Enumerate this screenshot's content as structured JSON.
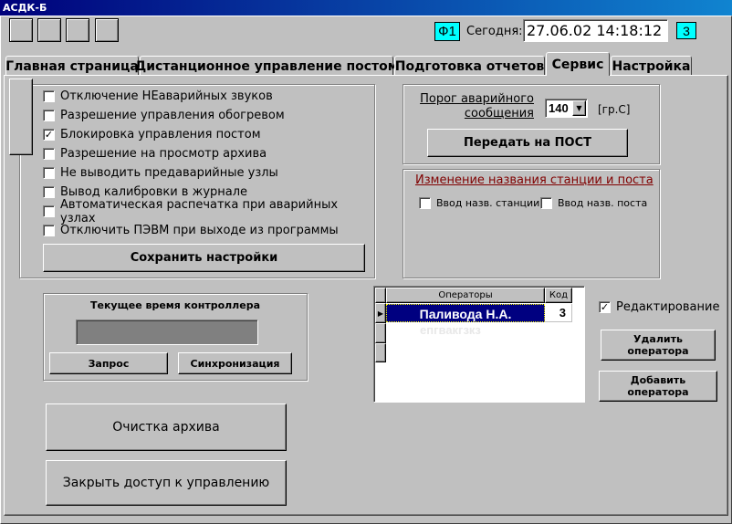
{
  "titlebar": {
    "title": "АСДК-Б"
  },
  "header": {
    "f1_label": "Ф1",
    "today_label": "Сегодня:",
    "datetime": "27.06.02 14:18:12",
    "badge_label": "3"
  },
  "tabs": [
    {
      "label": "Главная страница"
    },
    {
      "label": "Дистанционное управление постом"
    },
    {
      "label": "Подготовка отчетов"
    },
    {
      "label": "Сервис"
    },
    {
      "label": "Настройка"
    }
  ],
  "settings": {
    "items": [
      {
        "label": "Отключение НЕаварийных звуков",
        "checked": false
      },
      {
        "label": "Разрешение управления обогревом",
        "checked": false
      },
      {
        "label": "Блокировка управления постом",
        "checked": true
      },
      {
        "label": "Разрешение на просмотр архива",
        "checked": false
      },
      {
        "label": "Не выводить  предаварийные узлы",
        "checked": false
      },
      {
        "label": "Вывод калибровки в журнале",
        "checked": false
      },
      {
        "label": "Автоматическая распечатка при аварийных узлах",
        "checked": false
      },
      {
        "label": "Отключить ПЭВМ при выходе из программы",
        "checked": false
      }
    ],
    "save_label": "Сохранить настройки"
  },
  "threshold": {
    "label_line1": "Порог аварийного",
    "label_line2": "сообщения",
    "value": "140",
    "unit": "[гр.С]",
    "send_label": "Передать на ПОСТ"
  },
  "station": {
    "title": "Изменение названия станции и поста",
    "station_input_label": "Ввод назв. станции",
    "post_input_label": "Ввод назв. поста"
  },
  "controller": {
    "title": "Текущее время контроллера",
    "time_value": "",
    "request_label": "Запрос",
    "sync_label": "Синхронизация"
  },
  "operators": {
    "columns": [
      "Операторы",
      "Код"
    ],
    "rows": [
      {
        "name": "Паливода Н.А.",
        "code": "3"
      }
    ],
    "ghost_text": "епгвакгзкз",
    "edit_label": "Редактирование",
    "edit_checked": true,
    "delete_label": "Удалить оператора",
    "add_label": "Добавить оператора"
  },
  "actions": {
    "clear_archive_label": "Очистка архива",
    "close_access_label": "Закрыть доступ к управлению"
  },
  "colors": {
    "titlebar": "#00007b",
    "badge": "#00ffff",
    "selection": "#000080",
    "station_title": "#800000"
  }
}
